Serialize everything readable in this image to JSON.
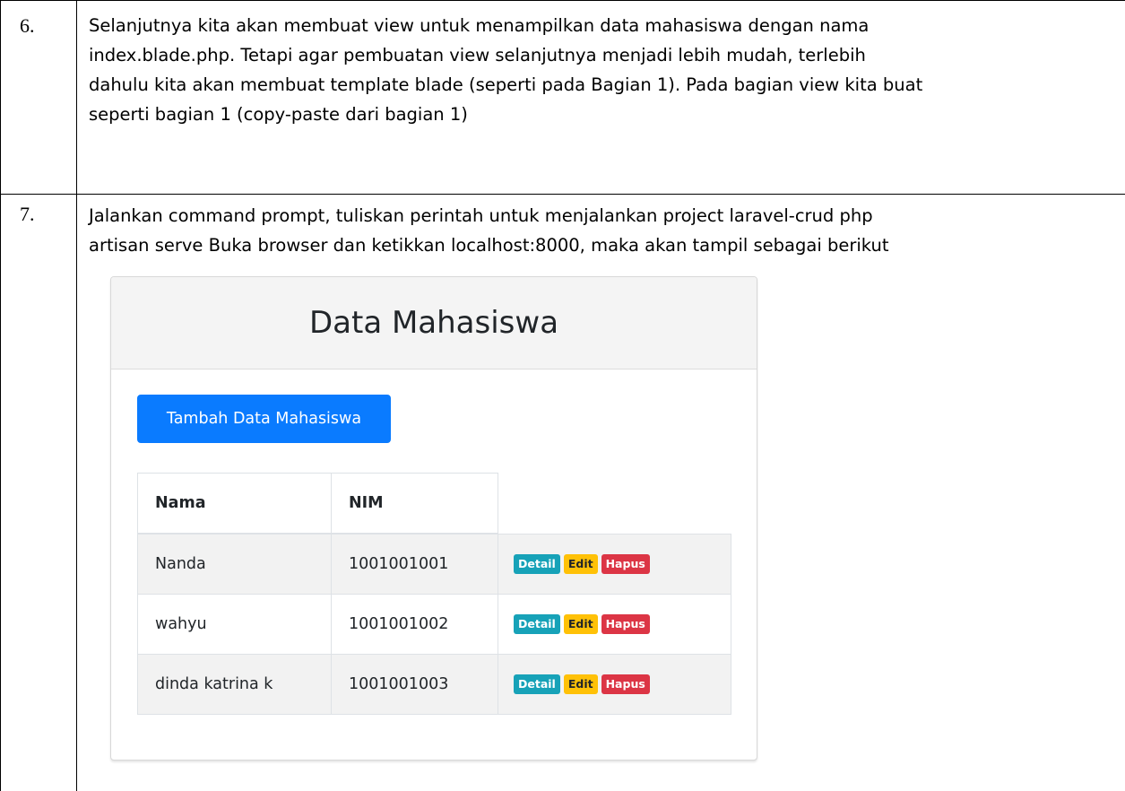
{
  "rows": [
    {
      "number": "6.",
      "lines": [
        "Selanjutnya kita akan membuat view untuk menampilkan data mahasiswa dengan nama",
        "index.blade.php. Tetapi agar pembuatan view selanjutnya menjadi lebih mudah, terlebih",
        "dahulu kita akan membuat template blade (seperti pada Bagian 1). Pada bagian view kita buat",
        "seperti bagian 1 (copy-paste dari bagian 1)"
      ]
    },
    {
      "number": "7.",
      "lines": [
        "Jalankan command prompt, tuliskan perintah untuk menjalankan project laravel-crud php",
        "artisan serve Buka browser dan ketikkan localhost:8000, maka akan tampil sebagai berikut"
      ]
    }
  ],
  "app": {
    "title": "Data Mahasiswa",
    "add_button": "Tambah Data Mahasiswa",
    "columns": [
      "Nama",
      "NIM"
    ],
    "students": [
      {
        "nama": "Nanda",
        "nim": "1001001001"
      },
      {
        "nama": "wahyu",
        "nim": "1001001002"
      },
      {
        "nama": "dinda katrina k",
        "nim": "1001001003"
      }
    ],
    "actions": {
      "detail": "Detail",
      "edit": "Edit",
      "hapus": "Hapus"
    }
  },
  "colors": {
    "primary": "#0a7bff",
    "info": "#17a2b8",
    "warning": "#ffc107",
    "danger": "#dc3545"
  }
}
